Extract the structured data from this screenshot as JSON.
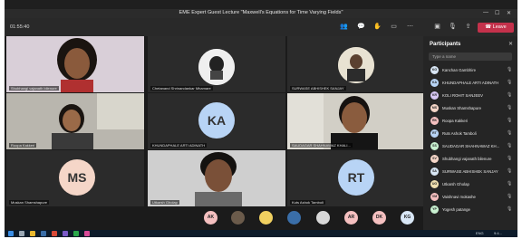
{
  "window": {
    "title": "EME Expert Guest Lecture \"Maxwell's Equations for Time Varying Fields\"",
    "minimize": "—",
    "maximize": "☐",
    "close": "✕"
  },
  "toolbar": {
    "timer": "01:55:40",
    "leave_label": "Leave"
  },
  "tiles": [
    {
      "name": "Shubhangi vajanath bilenure",
      "kind": "photo-woman"
    },
    {
      "name": "Chetanand Shrinandankar Mhamare",
      "kind": "logo"
    },
    {
      "name": "SURWASE ABHISHEK SANJAY",
      "kind": "photo-man"
    },
    {
      "name": "Roopa Kakkeri",
      "kind": "photo-woman2"
    },
    {
      "name": "KHUNDAPHALE ARTI ADINATH",
      "initials": "KA",
      "color": "#b8d4f5"
    },
    {
      "name": "SAUDAGAR SHAHNAWAZ KHALI...",
      "kind": "photo-man2"
    },
    {
      "name": "Muskan Shamshapure",
      "initials": "MS",
      "color": "#f5d6c8"
    },
    {
      "name": "Utkarsh Gholap",
      "kind": "photo-man3"
    },
    {
      "name": "Kuts Ashok Tamboli",
      "initials": "RT",
      "color": "#b8d4f5"
    }
  ],
  "bottom_chips": [
    {
      "label": "AK",
      "color": "#f5c0c0"
    },
    {
      "label": "",
      "color": "#6b5b4b"
    },
    {
      "label": "",
      "color": "#f0d060"
    },
    {
      "label": "",
      "color": "#3a6ea8"
    },
    {
      "label": "",
      "color": "#d8d8d8"
    },
    {
      "label": "AR",
      "color": "#f5c0c0"
    },
    {
      "label": "DK",
      "color": "#f5c0c0"
    },
    {
      "label": "KG",
      "color": "#d8e6f5"
    }
  ],
  "panel": {
    "title": "Participants",
    "search_placeholder": "Type a name",
    "participants": [
      {
        "name": "Kanchan Gambhire",
        "initials": "KG",
        "color": "#d8e6f5"
      },
      {
        "name": "KHUNDAPHALE ARTI ADINATH",
        "initials": "KA",
        "color": "#b8d4f5"
      },
      {
        "name": "KOLI ROHIT SANJEEV",
        "initials": "KR",
        "color": "#d8c8f5"
      },
      {
        "name": "Muskan Shamshapure",
        "initials": "MS",
        "color": "#f5d6c8"
      },
      {
        "name": "Roopa Kakkeri",
        "initials": "RK",
        "color": "#f5c0c0"
      },
      {
        "name": "Ruts Ashok Tamboli",
        "initials": "RT",
        "color": "#b8d4f5"
      },
      {
        "name": "SAUDAGAR SHAHNAWAZ KH...",
        "initials": "SS",
        "color": "#c8f0d0"
      },
      {
        "name": "Shubhangi vajanath bilenure",
        "initials": "SV",
        "color": "#f5d6c8"
      },
      {
        "name": "SURWASE ABHISHEK SANJAY",
        "initials": "SA",
        "color": "#d8e6f5"
      },
      {
        "name": "Utkarsh Gholap",
        "initials": "UG",
        "color": "#f0e0b0"
      },
      {
        "name": "Vaishnavi mokashe",
        "initials": "VM",
        "color": "#f5c0c0"
      },
      {
        "name": "Yogesh patange",
        "initials": "YP",
        "color": "#c8f0d0"
      }
    ]
  },
  "taskbar": {
    "tray_lang": "ENG",
    "tray_time": "9:4..."
  }
}
